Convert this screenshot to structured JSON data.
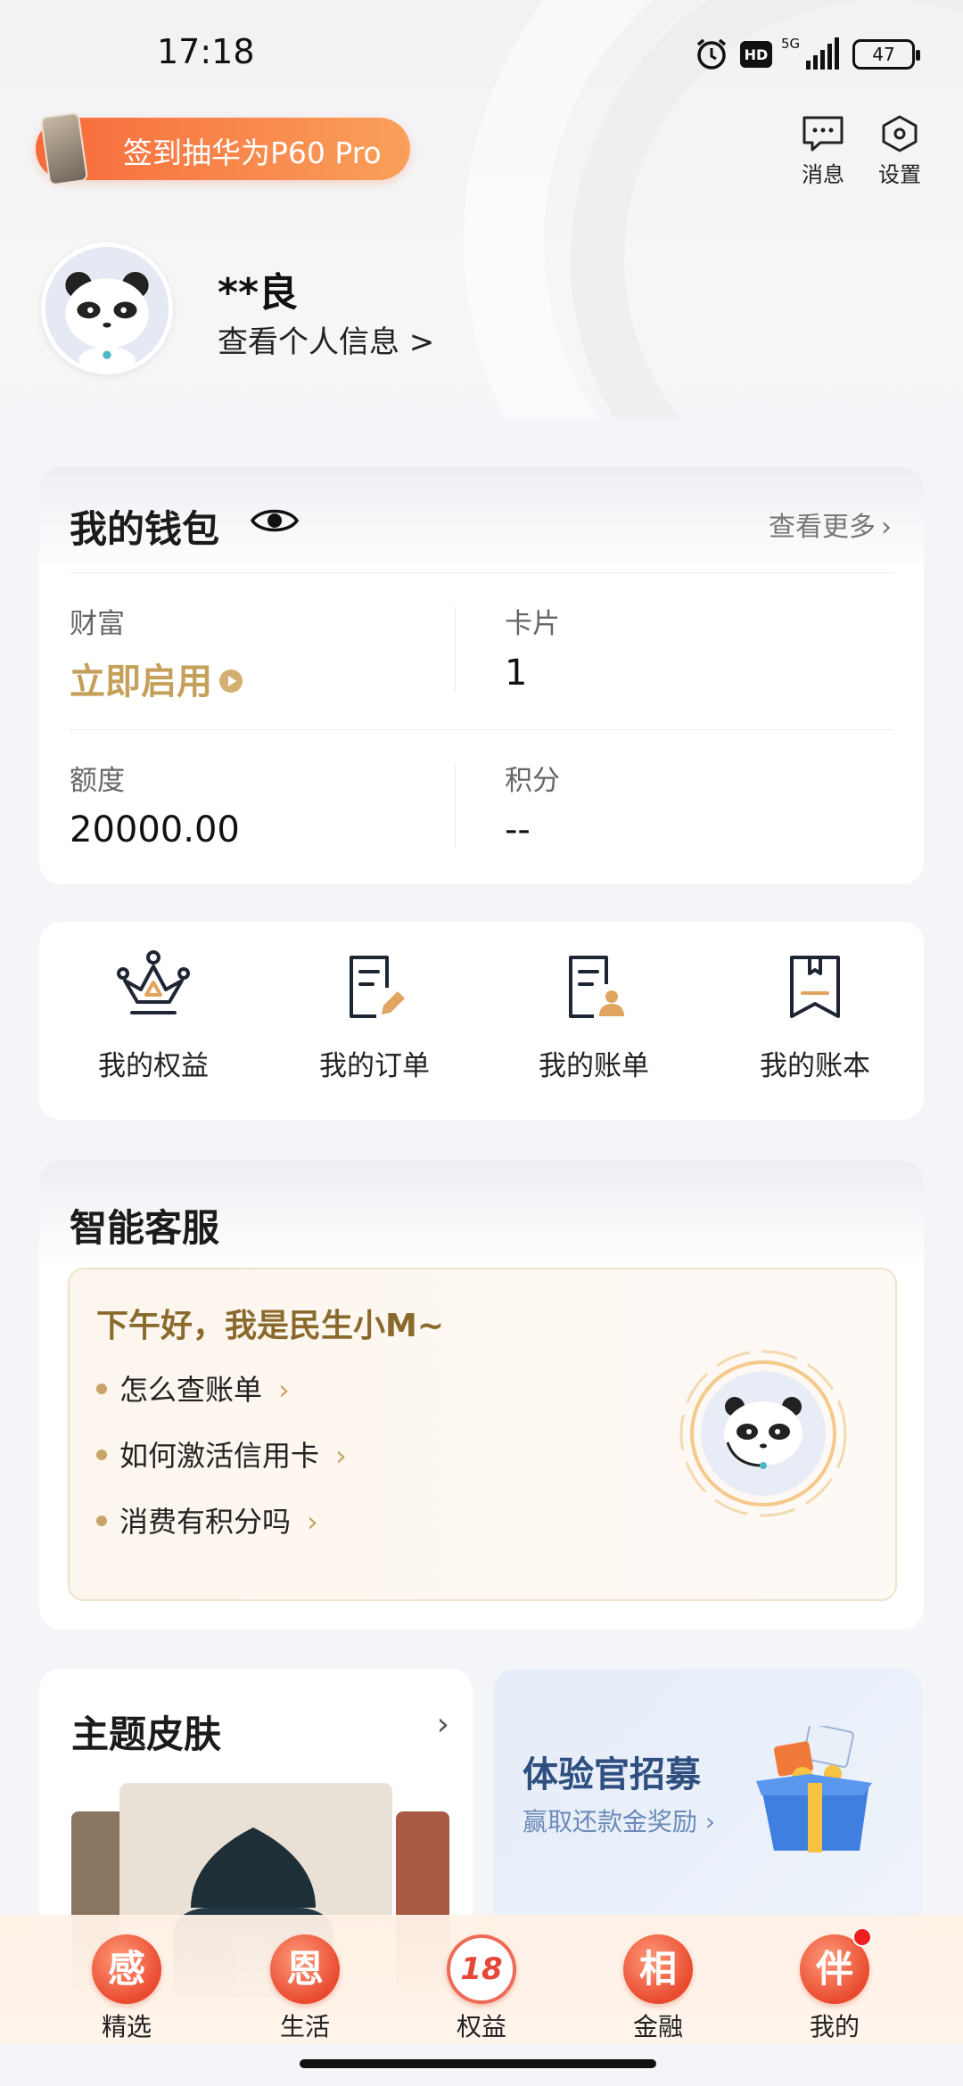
{
  "status_bar": {
    "time": "17:18",
    "hd": "HD",
    "network": "5G",
    "battery": "47"
  },
  "header": {
    "promo_label": "签到抽华为P60 Pro",
    "messages_label": "消息",
    "settings_label": "设置"
  },
  "profile": {
    "name": "**良",
    "info_link": "查看个人信息 >"
  },
  "wallet": {
    "title": "我的钱包",
    "more_label": "查看更多",
    "items": [
      {
        "label": "财富",
        "value": "立即启用"
      },
      {
        "label": "卡片",
        "value": "1"
      },
      {
        "label": "额度",
        "value": "20000.00"
      },
      {
        "label": "积分",
        "value": "--"
      }
    ]
  },
  "quick_actions": [
    {
      "label": "我的权益",
      "icon": "crown-icon"
    },
    {
      "label": "我的订单",
      "icon": "order-edit-icon"
    },
    {
      "label": "我的账单",
      "icon": "bill-user-icon"
    },
    {
      "label": "我的账本",
      "icon": "ledger-bookmark-icon"
    }
  ],
  "service": {
    "title": "智能客服",
    "greeting": "下午好，我是民生小M~",
    "questions": [
      "怎么查账单",
      "如何激活信用卡",
      "消费有积分吗"
    ]
  },
  "theme": {
    "title": "主题皮肤"
  },
  "recruit": {
    "title": "体验官招募",
    "subtitle": "赢取还款金奖励"
  },
  "bottom_nav": [
    {
      "label": "精选",
      "glyph": "感"
    },
    {
      "label": "生活",
      "glyph": "恩"
    },
    {
      "label": "权益",
      "glyph": "18"
    },
    {
      "label": "金融",
      "glyph": "相"
    },
    {
      "label": "我的",
      "glyph": "伴",
      "badge": true
    }
  ],
  "colors": {
    "accent_gold": "#c5a05a",
    "promo_orange": "#f86a3a",
    "nav_red": "#e94b2f",
    "recruit_blue": "#2f4f80"
  }
}
